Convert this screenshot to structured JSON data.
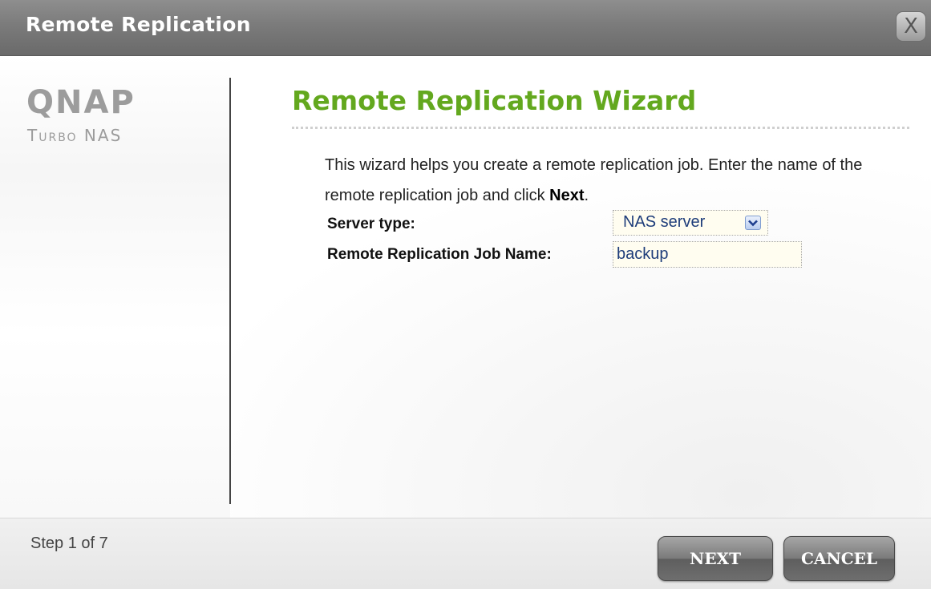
{
  "window": {
    "title": "Remote Replication",
    "close_label": "X"
  },
  "sidebar": {
    "logo_text": "QNAP",
    "logo_subtext": "Turbo NAS"
  },
  "main": {
    "heading": "Remote Replication Wizard",
    "description_part1": "This wizard helps you create a remote replication job.  Enter the name of the remote replication job and click ",
    "description_bold": "Next",
    "description_end": ".",
    "server_type_label": "Server type:",
    "server_type_value": "NAS server",
    "job_name_label": "Remote Replication Job Name:",
    "job_name_value": "backup"
  },
  "footer": {
    "step_text": "Step 1 of 7",
    "next_label": "NEXT",
    "cancel_label": "CANCEL"
  },
  "colors": {
    "heading": "#63a81e",
    "titlebar": "#7b7b7b",
    "input_text": "#1e3d7a",
    "button": "#6e6e6e"
  },
  "icons": {
    "close": "close-icon",
    "dropdown": "chevron-down-icon"
  }
}
